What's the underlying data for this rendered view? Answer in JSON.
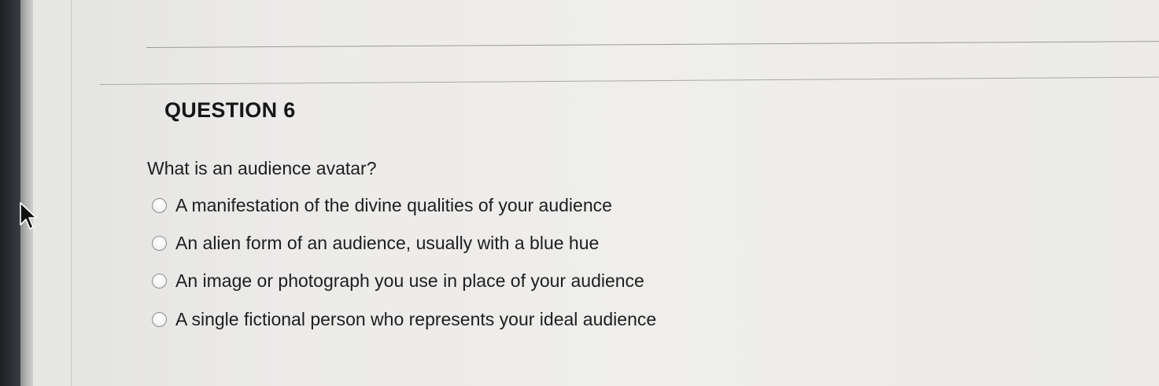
{
  "question": {
    "heading": "QUESTION 6",
    "prompt": "What is an audience avatar?",
    "choices": [
      {
        "label": "A manifestation of the divine qualities of your audience",
        "selected": false
      },
      {
        "label": "An alien form of an audience, usually with a blue hue",
        "selected": false
      },
      {
        "label": "An image or photograph you use in place of your audience",
        "selected": false
      },
      {
        "label": "A single fictional person who represents your ideal audience",
        "selected": false
      }
    ]
  },
  "icons": {
    "cursor": "mouse-pointer-icon",
    "radio": "radio-button-icon"
  }
}
